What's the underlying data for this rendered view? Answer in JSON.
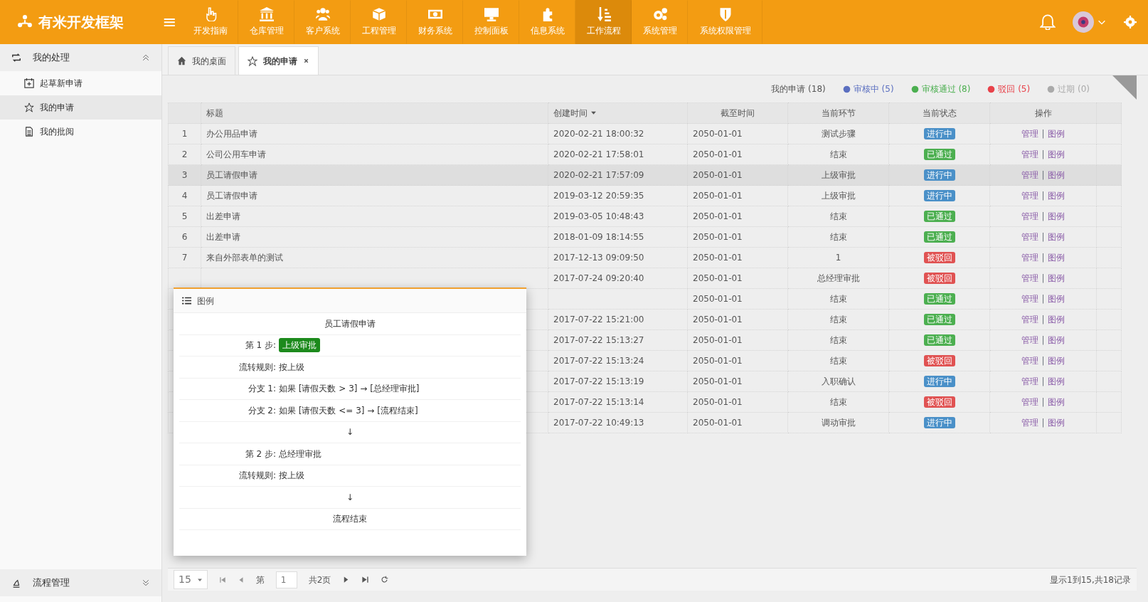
{
  "brand": {
    "title": "有米开发框架",
    "menu_icon": "≡"
  },
  "nav": [
    {
      "label": "开发指南",
      "selected": false
    },
    {
      "label": "仓库管理",
      "selected": false
    },
    {
      "label": "客户系统",
      "selected": false
    },
    {
      "label": "工程管理",
      "selected": false
    },
    {
      "label": "财务系统",
      "selected": false
    },
    {
      "label": "控制面板",
      "selected": false
    },
    {
      "label": "信息系统",
      "selected": false
    },
    {
      "label": "工作流程",
      "selected": true
    },
    {
      "label": "系统管理",
      "selected": false
    },
    {
      "label": "系统权限管理",
      "selected": false
    }
  ],
  "sidebar": {
    "sections": [
      {
        "title": "我的处理",
        "expanded": true,
        "items": [
          {
            "label": "起草新申请",
            "selected": false
          },
          {
            "label": "我的申请",
            "selected": true
          },
          {
            "label": "我的批阅",
            "selected": false
          }
        ]
      },
      {
        "title": "流程管理",
        "expanded": false
      }
    ]
  },
  "tabs": [
    {
      "label": "我的桌面",
      "selected": false,
      "closable": false
    },
    {
      "label": "我的申请",
      "selected": true,
      "closable": true
    }
  ],
  "legend": [
    {
      "kind": "total",
      "label": "我的申请",
      "count": "(18)"
    },
    {
      "kind": "status",
      "label": "审核中",
      "count": "(5)",
      "color": "#5b6fc0"
    },
    {
      "kind": "status",
      "label": "审核通过",
      "count": "(8)",
      "color": "#4caf50"
    },
    {
      "kind": "status",
      "label": "驳回",
      "count": "(5)",
      "color": "#e8424a"
    },
    {
      "kind": "status",
      "label": "过期",
      "count": "(0)",
      "color": "#aaaaaa"
    }
  ],
  "table": {
    "columns": [
      {
        "label": "标题",
        "sorted": false
      },
      {
        "label": "创建时间",
        "sorted": true
      },
      {
        "label": "截至时间",
        "sorted": false
      },
      {
        "label": "当前环节",
        "sorted": false
      },
      {
        "label": "当前状态",
        "sorted": false
      },
      {
        "label": "操作",
        "sorted": false
      }
    ],
    "action_separator": "|",
    "rows": [
      {
        "num": "1",
        "title": "办公用品申请",
        "created": "2020-02-21 18:00:32",
        "deadline": "2050-01-01",
        "step": "测试步骤",
        "status": {
          "kind": "running",
          "label": "进行中"
        },
        "actions": [
          "管理",
          "图例"
        ],
        "selected": false
      },
      {
        "num": "2",
        "title": "公司公用车申请",
        "created": "2020-02-21 17:58:01",
        "deadline": "2050-01-01",
        "step": "结束",
        "status": {
          "kind": "passed",
          "label": "已通过"
        },
        "actions": [
          "管理",
          "图例"
        ],
        "selected": false
      },
      {
        "num": "3",
        "title": "员工请假申请",
        "created": "2020-02-21 17:57:09",
        "deadline": "2050-01-01",
        "step": "上级审批",
        "status": {
          "kind": "running",
          "label": "进行中"
        },
        "actions": [
          "管理",
          "图例"
        ],
        "selected": true
      },
      {
        "num": "4",
        "title": "员工请假申请",
        "created": "2019-03-12 20:59:35",
        "deadline": "2050-01-01",
        "step": "上级审批",
        "status": {
          "kind": "running",
          "label": "进行中"
        },
        "actions": [
          "管理",
          "图例"
        ],
        "selected": false
      },
      {
        "num": "5",
        "title": "出差申请",
        "created": "2019-03-05 10:48:43",
        "deadline": "2050-01-01",
        "step": "结束",
        "status": {
          "kind": "passed",
          "label": "已通过"
        },
        "actions": [
          "管理",
          "图例"
        ],
        "selected": false
      },
      {
        "num": "6",
        "title": "出差申请",
        "created": "2018-01-09 18:14:55",
        "deadline": "2050-01-01",
        "step": "结束",
        "status": {
          "kind": "passed",
          "label": "已通过"
        },
        "actions": [
          "管理",
          "图例"
        ],
        "selected": false
      },
      {
        "num": "7",
        "title": "来自外部表单的测试",
        "created": "2017-12-13 09:09:50",
        "deadline": "2050-01-01",
        "step": "1",
        "status": {
          "kind": "rejected",
          "label": "被驳回"
        },
        "actions": [
          "管理",
          "图例"
        ],
        "selected": false
      },
      {
        "created": "2017-07-24 09:20:40",
        "deadline": "2050-01-01",
        "step": "总经理审批",
        "status": {
          "kind": "rejected",
          "label": "被驳回"
        },
        "actions": [
          "管理",
          "图例"
        ],
        "selected": false
      },
      {
        "deadline": "2050-01-01",
        "step": "结束",
        "status": {
          "kind": "passed",
          "label": "已通过"
        },
        "actions": [
          "管理",
          "图例"
        ],
        "selected": false
      },
      {
        "created": "2017-07-22 15:21:00",
        "deadline": "2050-01-01",
        "step": "结束",
        "status": {
          "kind": "passed",
          "label": "已通过"
        },
        "actions": [
          "管理",
          "图例"
        ],
        "selected": false
      },
      {
        "created": "2017-07-22 15:13:27",
        "deadline": "2050-01-01",
        "step": "结束",
        "status": {
          "kind": "passed",
          "label": "已通过"
        },
        "actions": [
          "管理",
          "图例"
        ],
        "selected": false
      },
      {
        "created": "2017-07-22 15:13:24",
        "deadline": "2050-01-01",
        "step": "结束",
        "status": {
          "kind": "rejected",
          "label": "被驳回"
        },
        "actions": [
          "管理",
          "图例"
        ],
        "selected": false
      },
      {
        "created": "2017-07-22 15:13:19",
        "deadline": "2050-01-01",
        "step": "入职确认",
        "status": {
          "kind": "running",
          "label": "进行中"
        },
        "actions": [
          "管理",
          "图例"
        ],
        "selected": false
      },
      {
        "created": "2017-07-22 15:13:14",
        "deadline": "2050-01-01",
        "step": "结束",
        "status": {
          "kind": "rejected",
          "label": "被驳回"
        },
        "actions": [
          "管理",
          "图例"
        ],
        "selected": false
      },
      {
        "created": "2017-07-22 10:49:13",
        "deadline": "2050-01-01",
        "step": "调动审批",
        "status": {
          "kind": "running",
          "label": "进行中"
        },
        "actions": [
          "管理",
          "图例"
        ],
        "selected": false
      }
    ]
  },
  "popup": {
    "title": "图例",
    "lines": [
      {
        "kind": "title",
        "text": "员工请假申请"
      },
      {
        "kind": "field",
        "label": "第 1 步:",
        "value": "上级审批",
        "badge": true
      },
      {
        "kind": "field",
        "label": "流转规则:",
        "value": "按上级",
        "badge": false
      },
      {
        "kind": "field",
        "label": "分支 1:",
        "value": "如果 [请假天数 > 3] → [总经理审批]",
        "badge": false
      },
      {
        "kind": "field",
        "label": "分支 2:",
        "value": "如果 [请假天数 <= 3] → [流程结束]",
        "badge": false
      },
      {
        "kind": "arrow",
        "text": "↓"
      },
      {
        "kind": "field",
        "label": "第 2 步:",
        "value": "总经理审批",
        "badge": false
      },
      {
        "kind": "field",
        "label": "流转规则:",
        "value": "按上级",
        "badge": false
      },
      {
        "kind": "arrow",
        "text": "↓"
      },
      {
        "kind": "title",
        "text": "流程结束"
      }
    ]
  },
  "pager": {
    "page_size": "15",
    "page_prefix": "第",
    "page": "1",
    "pages": "共2页",
    "info": "显示1到15,共18记录"
  }
}
